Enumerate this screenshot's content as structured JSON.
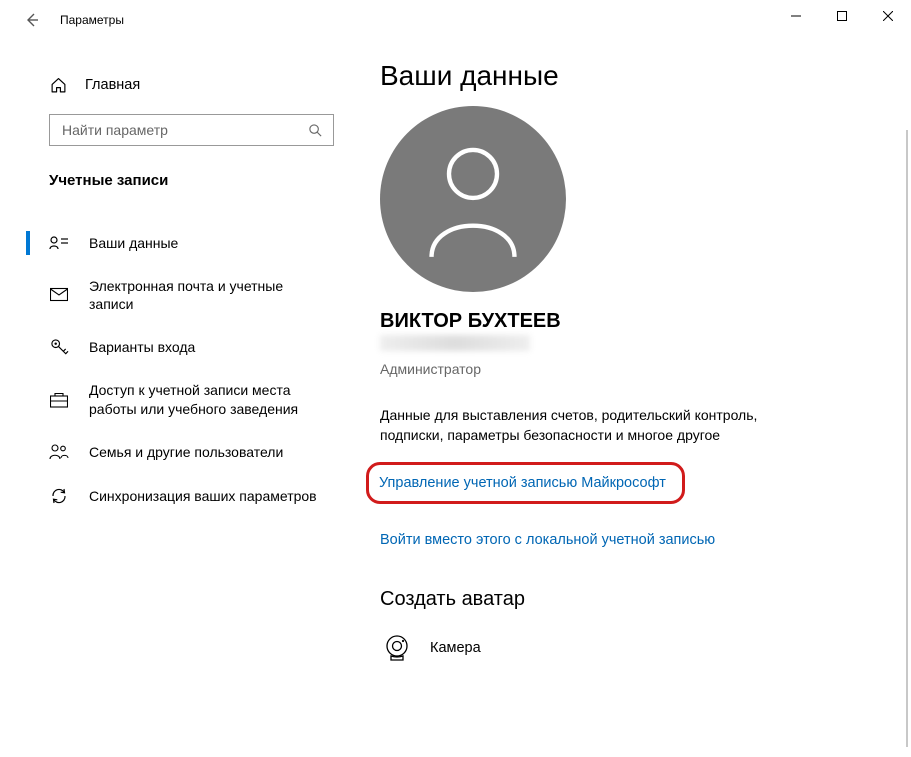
{
  "window": {
    "title": "Параметры"
  },
  "sidebar": {
    "home": "Главная",
    "search_placeholder": "Найти параметр",
    "section": "Учетные записи",
    "items": [
      {
        "label": "Ваши данные",
        "active": true
      },
      {
        "label": "Электронная почта и учетные записи",
        "active": false
      },
      {
        "label": "Варианты входа",
        "active": false
      },
      {
        "label": "Доступ к учетной записи места работы или учебного заведения",
        "active": false
      },
      {
        "label": "Семья и другие пользователи",
        "active": false
      },
      {
        "label": "Синхронизация ваших параметров",
        "active": false
      }
    ]
  },
  "main": {
    "heading": "Ваши данные",
    "user_name": "ВИКТОР БУХТЕЕВ",
    "user_role": "Администратор",
    "description": "Данные для выставления счетов, родительский контроль, подписки, параметры безопасности и многое другое",
    "link_manage": "Управление учетной записью Майкрософт",
    "link_local": "Войти вместо этого с локальной учетной записью",
    "avatar_heading": "Создать аватар",
    "camera": "Камера"
  }
}
